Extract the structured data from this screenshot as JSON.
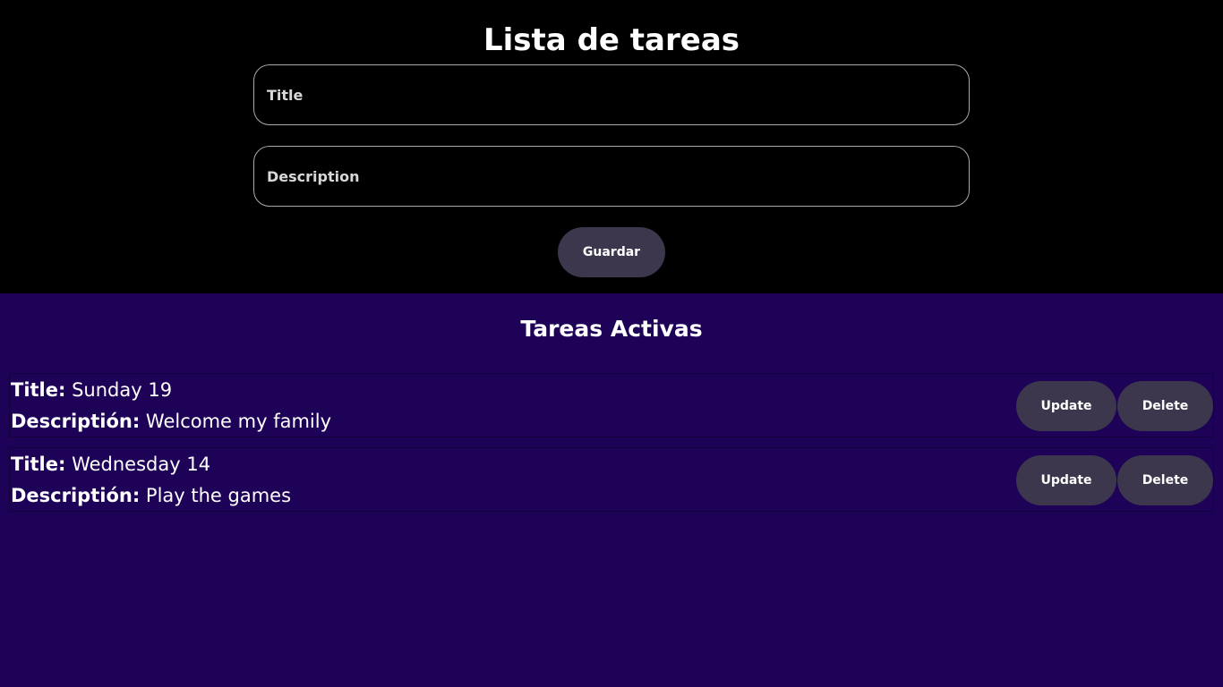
{
  "header": {
    "title": "Lista de tareas"
  },
  "form": {
    "title_placeholder": "Title",
    "title_value": "",
    "description_placeholder": "Description",
    "description_value": "",
    "save_label": "Guardar"
  },
  "active": {
    "title": "Tareas Activas",
    "title_label": "Title:",
    "description_label": "Descriptión:",
    "update_label": "Update",
    "delete_label": "Delete",
    "tasks": [
      {
        "title": "Sunday 19",
        "description": "Welcome my family"
      },
      {
        "title": "Wednesday 14",
        "description": "Play the games"
      }
    ]
  },
  "colors": {
    "top_background": "#000000",
    "list_background": "#1d0257",
    "button_background": "#3c374d",
    "text": "#ffffff"
  }
}
